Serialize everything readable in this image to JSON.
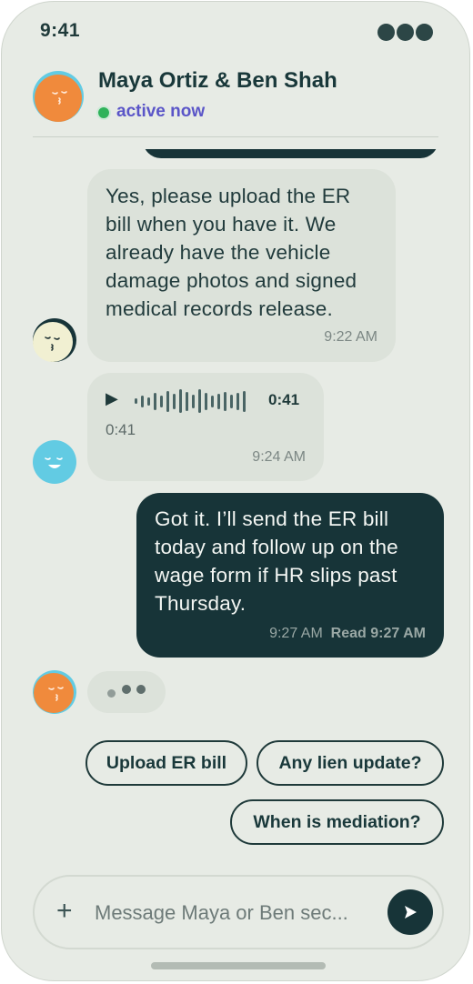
{
  "status_bar": {
    "time": "9:41"
  },
  "header": {
    "title": "Maya Ortiz & Ben Shah",
    "presence": "active now"
  },
  "messages": [
    {
      "direction": "incoming",
      "text": "Yes, please upload the ER bill when you have it. We already have the vehicle damage photos and signed medical records release.",
      "lines": [
        "Yes, please upload the ER",
        "bill when you have it. We",
        "already have the vehicle",
        "damage photos and signed",
        "medical records release."
      ],
      "time": "9:22 AM"
    },
    {
      "direction": "incoming",
      "type": "voice",
      "duration": "0:41",
      "caption": "0:41",
      "time": "9:24 AM"
    },
    {
      "direction": "outgoing",
      "text": "Got it. I’ll send the ER bill today and follow up on the wage form if HR slips past Thursday.",
      "lines": [
        "Got it. I’ll send the ER bill",
        "today and follow up on the",
        "wage form if HR slips past",
        "Thursday."
      ],
      "time": "9:27 AM",
      "read_receipt": "Read 9:27 AM"
    }
  ],
  "quick_replies": [
    "Upload ER bill",
    "Any lien update?",
    "When is mediation?"
  ],
  "composer": {
    "placeholder": "Message Maya or Ben sec...",
    "add_icon": "plus-icon",
    "send_icon": "send-icon"
  },
  "colors": {
    "background": "#e7ebe5",
    "outgoing_bubble": "#173438",
    "incoming_bubble": "#dce2da",
    "presence": "#2fb25a",
    "presence_text": "#5a55c8",
    "avatar_orange": "#f08a3c",
    "avatar_cyan": "#62cbe3",
    "avatar_cream": "#f1f0d2"
  }
}
